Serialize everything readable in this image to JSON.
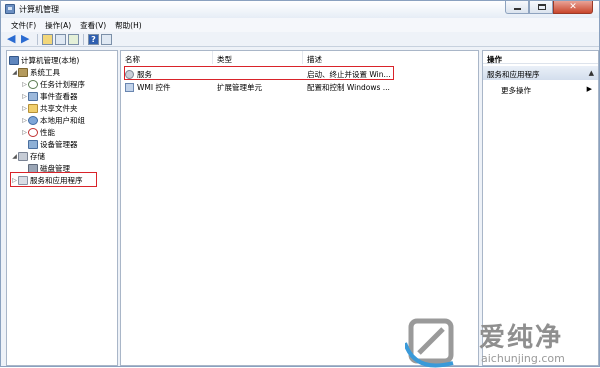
{
  "window": {
    "title": "计算机管理",
    "buttons": {
      "minimize": "minimize",
      "maximize": "maximize",
      "close": "✕"
    }
  },
  "menu": [
    "文件(F)",
    "操作(A)",
    "查看(V)",
    "帮助(H)"
  ],
  "tree": {
    "root": "计算机管理(本地)",
    "system_tools": "系统工具",
    "task_scheduler": "任务计划程序",
    "event_viewer": "事件查看器",
    "shared_folders": "共享文件夹",
    "local_users": "本地用户和组",
    "performance": "性能",
    "device_manager": "设备管理器",
    "storage": "存储",
    "disk_management": "磁盘管理",
    "services_apps": "服务和应用程序"
  },
  "list": {
    "columns": [
      "名称",
      "类型",
      "描述"
    ],
    "rows": [
      {
        "name": "服务",
        "type": "",
        "desc": "启动、终止并设置 Win..."
      },
      {
        "name": "WMI 控件",
        "type": "扩展管理单元",
        "desc": "配置和控制 Windows ..."
      }
    ]
  },
  "actions": {
    "header": "操作",
    "group": "服务和应用程序",
    "more": "更多操作"
  },
  "watermark": {
    "cn": "爱纯净",
    "en": "aichunjing.com"
  },
  "colors": {
    "highlight_box": "#d9232a",
    "accent": "#2a6bd1"
  }
}
